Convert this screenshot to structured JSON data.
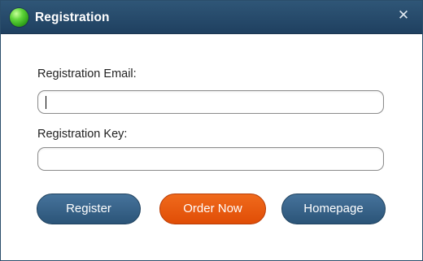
{
  "window": {
    "title": "Registration",
    "close_symbol": "✕",
    "icon": "green-orb-icon"
  },
  "form": {
    "email_label": "Registration Email:",
    "email_value": "",
    "key_label": "Registration Key:",
    "key_value": ""
  },
  "buttons": {
    "register": "Register",
    "order_now": "Order Now",
    "homepage": "Homepage"
  },
  "colors": {
    "titlebar": "#2a4d6d",
    "primary_button": "#336089",
    "accent_button": "#e85a10",
    "icon_green": "#4cc22a"
  }
}
